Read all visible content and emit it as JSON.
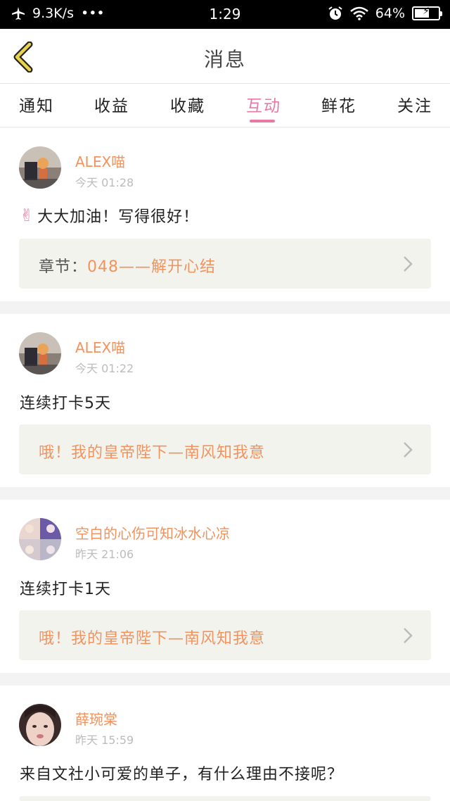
{
  "status_bar": {
    "speed": "9.3K/s",
    "dots": "•••",
    "time": "1:29",
    "battery": "64%",
    "battery_level": 0.64
  },
  "nav": {
    "title": "消息"
  },
  "tabs": [
    {
      "label": "通知"
    },
    {
      "label": "收益"
    },
    {
      "label": "收藏"
    },
    {
      "label": "互动",
      "active": true
    },
    {
      "label": "鲜花"
    },
    {
      "label": "关注"
    }
  ],
  "messages": [
    {
      "user": "ALEX喵",
      "time": "今天 01:28",
      "text": "大大加油！写得很好！",
      "emoji": "✌",
      "link_prefix": "章节：",
      "link": "048——解开心结"
    },
    {
      "user": "ALEX喵",
      "time": "今天 01:22",
      "text": "连续打卡5天",
      "link_prefix": "",
      "link": "哦！我的皇帝陛下—南风知我意"
    },
    {
      "user": "空白的心伤可知冰水心凉",
      "time": "昨天 21:06",
      "text": "连续打卡1天",
      "link_prefix": "",
      "link": "哦！我的皇帝陛下—南风知我意"
    },
    {
      "user": "薛琬棠",
      "time": "昨天 15:59",
      "text": "来自文社小可爱的单子，有什么理由不接呢？"
    }
  ],
  "colors": {
    "accent": "#e77aa4",
    "name": "#f0935f",
    "back_arrow": "#e8d34a"
  }
}
